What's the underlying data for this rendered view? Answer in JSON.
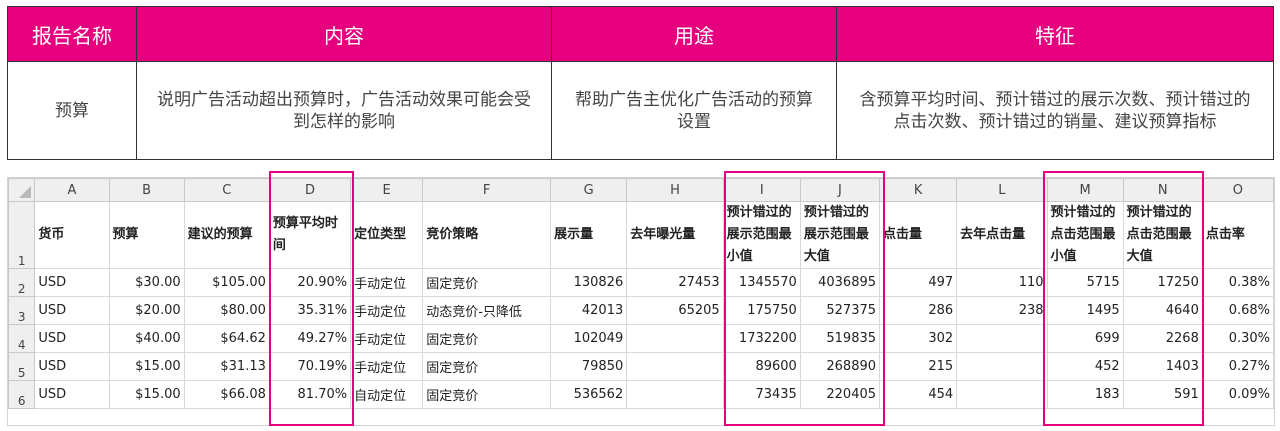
{
  "report": {
    "headers": [
      "报告名称",
      "内容",
      "用途",
      "特征"
    ],
    "row": {
      "name": "预算",
      "content": "说明广告活动超出预算时，广告活动效果可能会受到怎样的影响",
      "purpose": "帮助广告主优化广告活动的预算设置",
      "features": "含预算平均时间、预计错过的展示次数、预计错过的点击次数、预计错过的销量、建议预算指标"
    }
  },
  "sheet": {
    "columns": [
      "A",
      "B",
      "C",
      "D",
      "E",
      "F",
      "G",
      "H",
      "I",
      "J",
      "K",
      "L",
      "M",
      "N",
      "O"
    ],
    "row_numbers": [
      "1",
      "2",
      "3",
      "4",
      "5",
      "6"
    ],
    "headers": [
      "货币",
      "预算",
      "建议的预算",
      "预算平均时间",
      "定位类型",
      "竞价策略",
      "展示量",
      "去年曝光量",
      "预计错过的展示范围最小值",
      "预计错过的展示范围最大值",
      "点击量",
      "去年点击量",
      "预计错过的点击范围最小值",
      "预计错过的点击范围最大值",
      "点击率"
    ],
    "rows": [
      [
        "USD",
        "$30.00",
        "$105.00",
        "20.90%",
        "手动定位",
        "固定竞价",
        "130826",
        "27453",
        "1345570",
        "4036895",
        "497",
        "110",
        "5715",
        "17250",
        "0.38%"
      ],
      [
        "USD",
        "$20.00",
        "$80.00",
        "35.31%",
        "手动定位",
        "动态竞价-只降低",
        "42013",
        "65205",
        "175750",
        "527375",
        "286",
        "238",
        "1495",
        "4640",
        "0.68%"
      ],
      [
        "USD",
        "$40.00",
        "$64.62",
        "49.27%",
        "手动定位",
        "固定竞价",
        "102049",
        "",
        "1732200",
        "519835",
        "302",
        "",
        "699",
        "2268",
        "0.30%"
      ],
      [
        "USD",
        "$15.00",
        "$31.13",
        "70.19%",
        "手动定位",
        "固定竞价",
        "79850",
        "",
        "89600",
        "268890",
        "215",
        "",
        "452",
        "1403",
        "0.27%"
      ],
      [
        "USD",
        "$15.00",
        "$66.08",
        "81.70%",
        "自动定位",
        "固定竞价",
        "536562",
        "",
        "73435",
        "220405",
        "454",
        "",
        "183",
        "591",
        "0.09%"
      ]
    ]
  },
  "colors": {
    "accent": "#e6007e",
    "header_text": "#ffffff",
    "grid_header_bg": "#efefef"
  }
}
